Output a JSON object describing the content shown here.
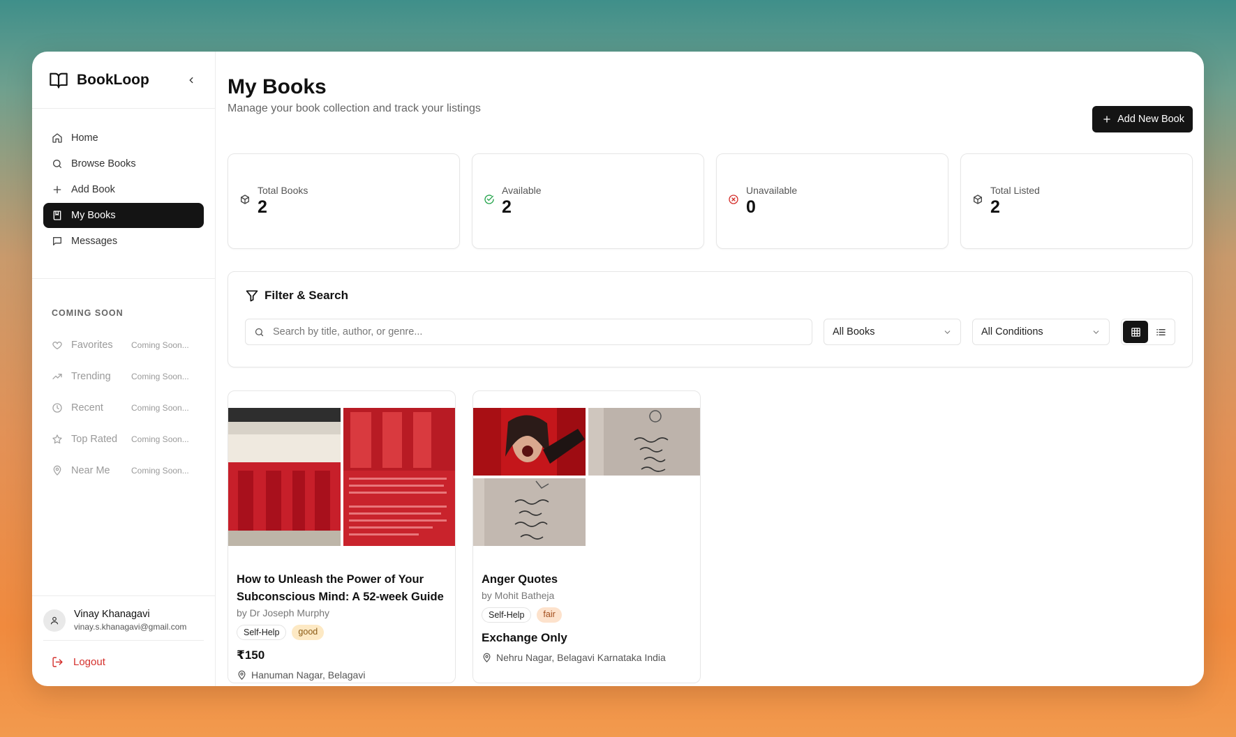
{
  "brand": {
    "name": "BookLoop"
  },
  "nav": [
    {
      "label": "Home",
      "icon": "home-icon"
    },
    {
      "label": "Browse Books",
      "icon": "search-icon"
    },
    {
      "label": "Add Book",
      "icon": "plus-icon"
    },
    {
      "label": "My Books",
      "icon": "book-icon",
      "active": true
    },
    {
      "label": "Messages",
      "icon": "message-icon"
    }
  ],
  "coming_soon": {
    "heading": "COMING SOON",
    "items": [
      {
        "label": "Favorites",
        "badge": "Coming Soon..."
      },
      {
        "label": "Trending",
        "badge": "Coming Soon..."
      },
      {
        "label": "Recent",
        "badge": "Coming Soon..."
      },
      {
        "label": "Top Rated",
        "badge": "Coming Soon..."
      },
      {
        "label": "Near Me",
        "badge": "Coming Soon..."
      }
    ]
  },
  "user": {
    "name": "Vinay Khanagavi",
    "email": "vinay.s.khanagavi@gmail.com",
    "logout": "Logout"
  },
  "page": {
    "title": "My Books",
    "subtitle": "Manage your book collection and track your listings",
    "add_button": "Add New Book"
  },
  "stats": [
    {
      "label": "Total Books",
      "value": "2"
    },
    {
      "label": "Available",
      "value": "2"
    },
    {
      "label": "Unavailable",
      "value": "0"
    },
    {
      "label": "Total Listed",
      "value": "2"
    }
  ],
  "filter": {
    "title": "Filter & Search",
    "search_placeholder": "Search by title, author, or genre...",
    "status_select": "All Books",
    "condition_select": "All Conditions"
  },
  "books": [
    {
      "title": "How to Unleash the Power of Your Subconscious Mind: A 52-week Guide",
      "author": "by Dr Joseph Murphy",
      "genre": "Self-Help",
      "condition": "good",
      "price": "₹150",
      "location": "Hanuman Nagar, Belagavi"
    },
    {
      "title": "Anger Quotes",
      "author": "by Mohit Batheja",
      "genre": "Self-Help",
      "condition": "fair",
      "price": "Exchange Only",
      "location": "Nehru Nagar, Belagavi Karnataka India"
    }
  ],
  "colors": {
    "primary": "#141414",
    "danger": "#d4302c",
    "success": "#22a34a"
  }
}
